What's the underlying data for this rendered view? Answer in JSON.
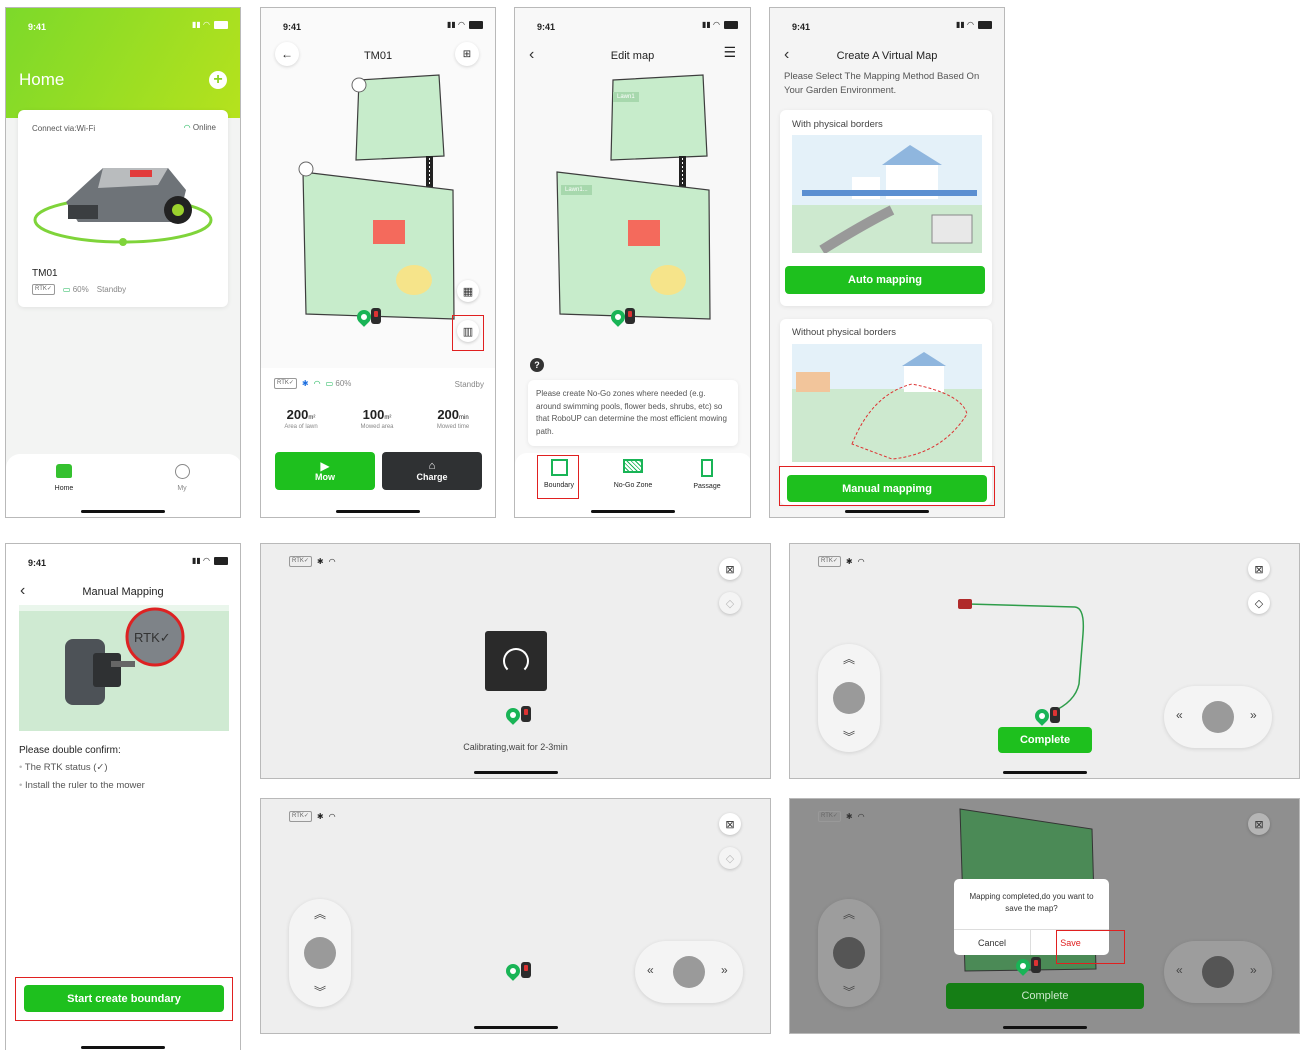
{
  "status_time": "9:41",
  "home": {
    "title": "Home",
    "connect_label": "Connect via:Wi-Fi",
    "online_label": "Online",
    "device_name": "TM01",
    "rtk": "RTK✓",
    "battery": "60%",
    "state": "Standby",
    "tab_home": "Home",
    "tab_my": "My"
  },
  "device": {
    "title": "TM01",
    "rtk": "RTK✓",
    "battery": "60%",
    "state": "Standby",
    "stat1_value": "200",
    "stat1_unit": "m²",
    "stat1_label": "Area of lawn",
    "stat2_value": "100",
    "stat2_unit": "m²",
    "stat2_label": "Mowed area",
    "stat3_value": "200",
    "stat3_unit": "min",
    "stat3_label": "Mowed time",
    "mow_label": "Mow",
    "charge_label": "Charge"
  },
  "edit_map": {
    "title": "Edit map",
    "lawn1_label": "Lawn1",
    "lawn2_label": "Lawn1...",
    "hint": "Please create No-Go zones where needed (e.g. around swimming pools, flower beds, shrubs, etc) so that RoboUP can determine the most efficient mowing path.",
    "tool_boundary": "Boundary",
    "tool_nogo": "No-Go Zone",
    "tool_passage": "Passage"
  },
  "virtual_map": {
    "title": "Create A Virtual Map",
    "subtitle": "Please Select The Mapping Method Based On Your Garden Environment.",
    "option1_title": "With physical borders",
    "option1_button": "Auto mapping",
    "option2_title": "Without physical borders",
    "option2_button": "Manual mappimg"
  },
  "manual": {
    "title": "Manual Mapping",
    "rtk_badge": "RTK✓",
    "confirm_title": "Please double confirm:",
    "item1": "The RTK status (✓)",
    "item2": "Install the ruler to the mower",
    "start_button": "Start create boundary"
  },
  "calibrating": {
    "rtk": "RTK✓",
    "message": "Calibrating,wait for 2-3min"
  },
  "drive": {
    "rtk": "RTK✓",
    "complete_label": "Complete"
  },
  "idle": {
    "rtk": "RTK✓"
  },
  "save_dialog": {
    "rtk": "RTK✓",
    "message": "Mapping completed,do you want to save the map?",
    "cancel": "Cancel",
    "save": "Save",
    "complete_label": "Complete"
  },
  "colors": {
    "primary_green": "#1ec01e",
    "lawn_green": "#c7eccb",
    "highlight_red": "#e02020",
    "dark_button": "#2f3133"
  }
}
